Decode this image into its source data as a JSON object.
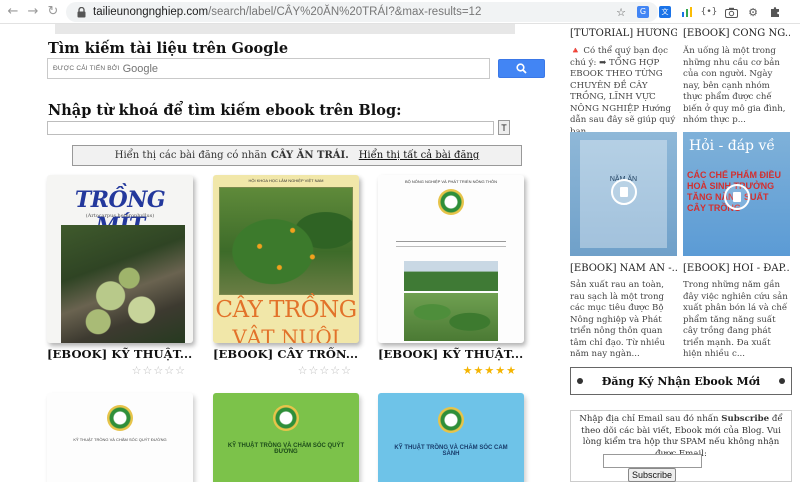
{
  "browser": {
    "url_host": "tailieunongnghiep.com",
    "url_path": "/search/label/CÂY%20ĂN%20TRÁI?&max-results=12",
    "extensions": [
      "star-icon",
      "google-translate-icon",
      "translate-icon",
      "bar-chart-icon",
      "code-icon",
      "camera-icon",
      "gear-icon",
      "puzzle-icon"
    ]
  },
  "google_search": {
    "heading": "Tìm kiếm tài liệu trên Google",
    "placeholder": "ĐƯỢC CẢI TIẾN BỞI",
    "brand": "Google"
  },
  "blog_search": {
    "heading": "Nhập từ khoá để tìm kiếm ebook trên Blog:",
    "button": "T"
  },
  "label_bar": {
    "prefix": "Hiển thị các bài đăng có nhãn",
    "label": "CÂY ĂN TRÁI.",
    "show_all": "Hiển thị tất cả bài đăng"
  },
  "posts": [
    {
      "title": "[EBOOK] KỸ THUẬT...",
      "cover_text": "TRỒNG MÍT",
      "cover_sub": "(Artocarpus heterophyllus)",
      "rating": 0
    },
    {
      "title": "[EBOOK] CÂY TRỒN...",
      "cover_text": "CÂY TRỒNG",
      "cover_sub": "VẬT NUÔI",
      "cover_top": "HỘI KHOA HỌC LÂM NGHIỆP VIỆT NAM",
      "rating": 0
    },
    {
      "title": "[EBOOK] KỸ THUẬT...",
      "cover_top": "BỘ NÔNG NGHIỆP VÀ PHÁT TRIỂN NÔNG THÔN",
      "rating": 5
    }
  ],
  "posts_row2": [
    {
      "cover_text": "KỸ THUẬT TRỒNG VÀ CHĂM SÓC QUÝT ĐƯỜNG"
    },
    {
      "cover_text": "KỸ THUẬT TRỒNG VÀ CHĂM SÓC QUÝT ĐƯỜNG"
    },
    {
      "cover_text": "KỸ THUẬT TRỒNG VÀ CHĂM SÓC CAM SÀNH"
    }
  ],
  "sidebar": {
    "top_left": {
      "title": "[TUTORIAL] HƯỚNG...",
      "text": "🔺 Có thể quý bạn đọc chú ý: ➡ TỔNG HỢP EBOOK THEO TỪNG CHUYÊN ĐỀ CÂY TRỒNG, LĨNH VỰC NÔNG NGHIỆP Hướng dẫn sau đây sẽ giúp quý bạn ..."
    },
    "top_right": {
      "title": "[EBOOK] CÔNG NG...",
      "text": "Ăn uống là một trong những nhu cầu cơ bản của con người. Ngày nay, bên cạnh nhóm thực phẩm được chế biến ở quy mô gia đình, nhóm thực p..."
    },
    "bottom_left": {
      "thumb_text": "NĂM ĂN",
      "title": "[EBOOK] NĂM ĂN -...",
      "text": "Sản xuất rau an toàn, rau sạch là một trong các mục tiêu được Bộ Nông nghiệp và Phát triển nông thôn quan tâm chỉ đạo. Từ nhiều năm nay ngàn..."
    },
    "bottom_right": {
      "thumb_text": "Hỏi - đáp về",
      "thumb_sub": "CÁC CHẾ PHẨM ĐIỀU HOÀ SINH TRƯỞNG TĂNG NĂNG SUẤT CÂY TRỒNG",
      "title": "[EBOOK] HỎI - ĐÁP...",
      "text": "Trong những năm gần đây việc nghiên cứu sản xuất phân bón lá và chế phẩm tăng năng suất cây trồng đang phát triển mạnh. Đa xuất hiện nhiều c..."
    },
    "subscribe_heading": "Đăng Ký Nhận Ebook Mới",
    "subscribe_text_1": "Nhập địa chỉ Email sau đó nhấn",
    "subscribe_text_bold": "Subscribe",
    "subscribe_text_2": "để theo dõi các bài viết, Ebook mới của Blog. Vui lòng kiểm tra hộp thư SPAM nếu không nhận được Email:",
    "subscribe_button": "Subscribe"
  },
  "colors": {
    "google_blue": "#4285f4",
    "star_gold": "#f4b400",
    "sidebar_thumb_blue": "#5b9bd5"
  }
}
